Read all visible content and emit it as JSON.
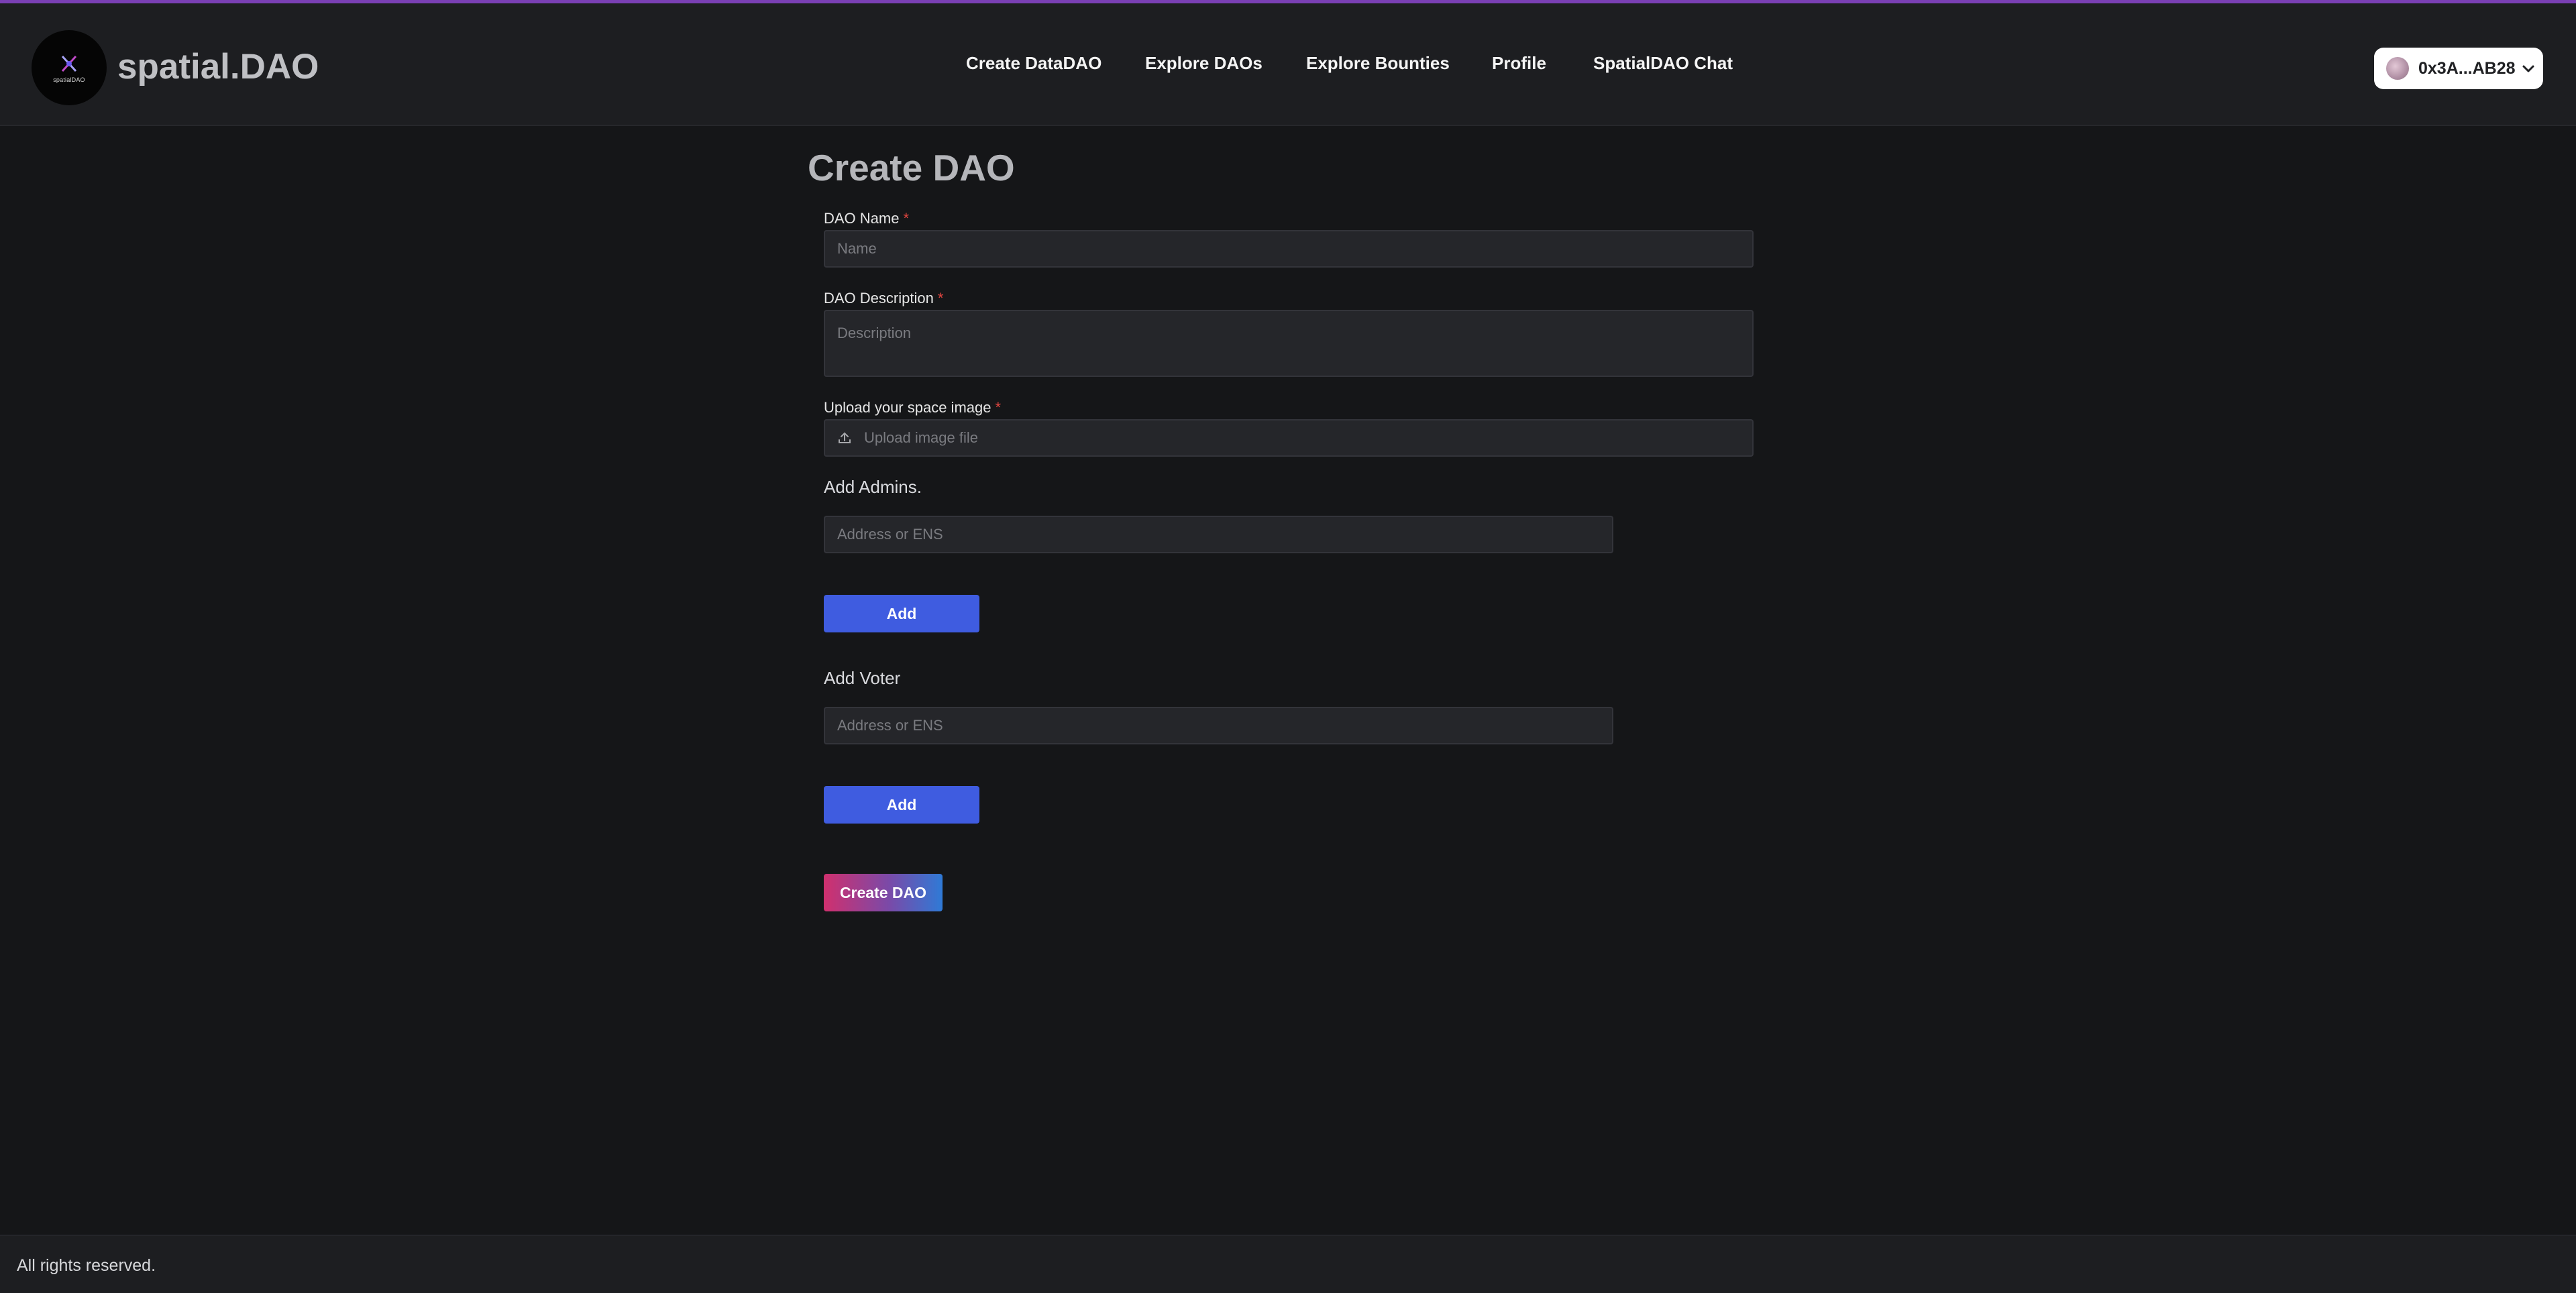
{
  "header": {
    "brand": "spatial.DAO",
    "logo_mini_text": "spatialDAO",
    "nav": [
      {
        "label": "Create DataDAO"
      },
      {
        "label": "Explore DAOs"
      },
      {
        "label": "Explore Bounties"
      },
      {
        "label": "Profile"
      },
      {
        "label": "SpatialDAO Chat"
      }
    ],
    "wallet": {
      "address": "0x3A...AB28",
      "icon": "chevron-down-icon"
    }
  },
  "form": {
    "title": "Create DAO",
    "dao_name": {
      "label": "DAO Name",
      "required_mark": "*",
      "placeholder": "Name",
      "value": ""
    },
    "dao_description": {
      "label": "DAO Description",
      "required_mark": "*",
      "placeholder": "Description",
      "value": ""
    },
    "space_image": {
      "label": "Upload your space image",
      "required_mark": "*",
      "placeholder": "Upload image file",
      "icon": "upload-icon"
    },
    "admins": {
      "label": "Add Admins.",
      "placeholder": "Address or ENS",
      "button": "Add"
    },
    "voters": {
      "label": "Add Voter",
      "placeholder": "Address or ENS",
      "button": "Add"
    },
    "submit": "Create DAO"
  },
  "footer": {
    "text": "All rights reserved."
  },
  "colors": {
    "accent_blue": "#3f5ce0",
    "gradient_start": "#d0306e",
    "gradient_end": "#2f7ad6",
    "background": "#151618",
    "required": "#e0453f"
  }
}
